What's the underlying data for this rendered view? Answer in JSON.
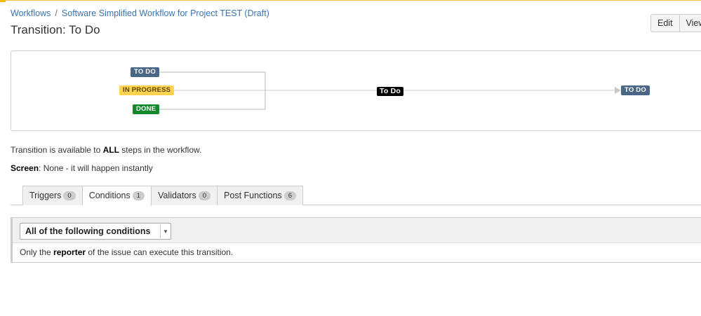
{
  "breadcrumb": {
    "root": "Workflows",
    "separator": "/",
    "current": "Software Simplified Workflow for Project TEST (Draft)"
  },
  "page_title": "Transition: To Do",
  "actions": {
    "edit": "Edit",
    "view": "View"
  },
  "diagram": {
    "source_statuses": [
      {
        "label": "TO DO",
        "color": "#4a6785"
      },
      {
        "label": "IN PROGRESS",
        "color": "#ffd351"
      },
      {
        "label": "DONE",
        "color": "#14892c"
      }
    ],
    "transition_label": "To Do",
    "target_status": {
      "label": "TO DO",
      "color": "#4a6785"
    }
  },
  "availability": {
    "prefix": "Transition is available to ",
    "emphasis": "ALL",
    "suffix": " steps in the workflow."
  },
  "screen": {
    "label": "Screen",
    "value": ": None - it will happen instantly"
  },
  "tabs": [
    {
      "label": "Triggers",
      "count": "0"
    },
    {
      "label": "Conditions",
      "count": "1"
    },
    {
      "label": "Validators",
      "count": "0"
    },
    {
      "label": "Post Functions",
      "count": "6"
    }
  ],
  "conditions": {
    "selector": "All of the following conditions",
    "rule": {
      "prefix": "Only the ",
      "emphasis": "reporter",
      "suffix": " of the issue can execute this transition."
    }
  }
}
